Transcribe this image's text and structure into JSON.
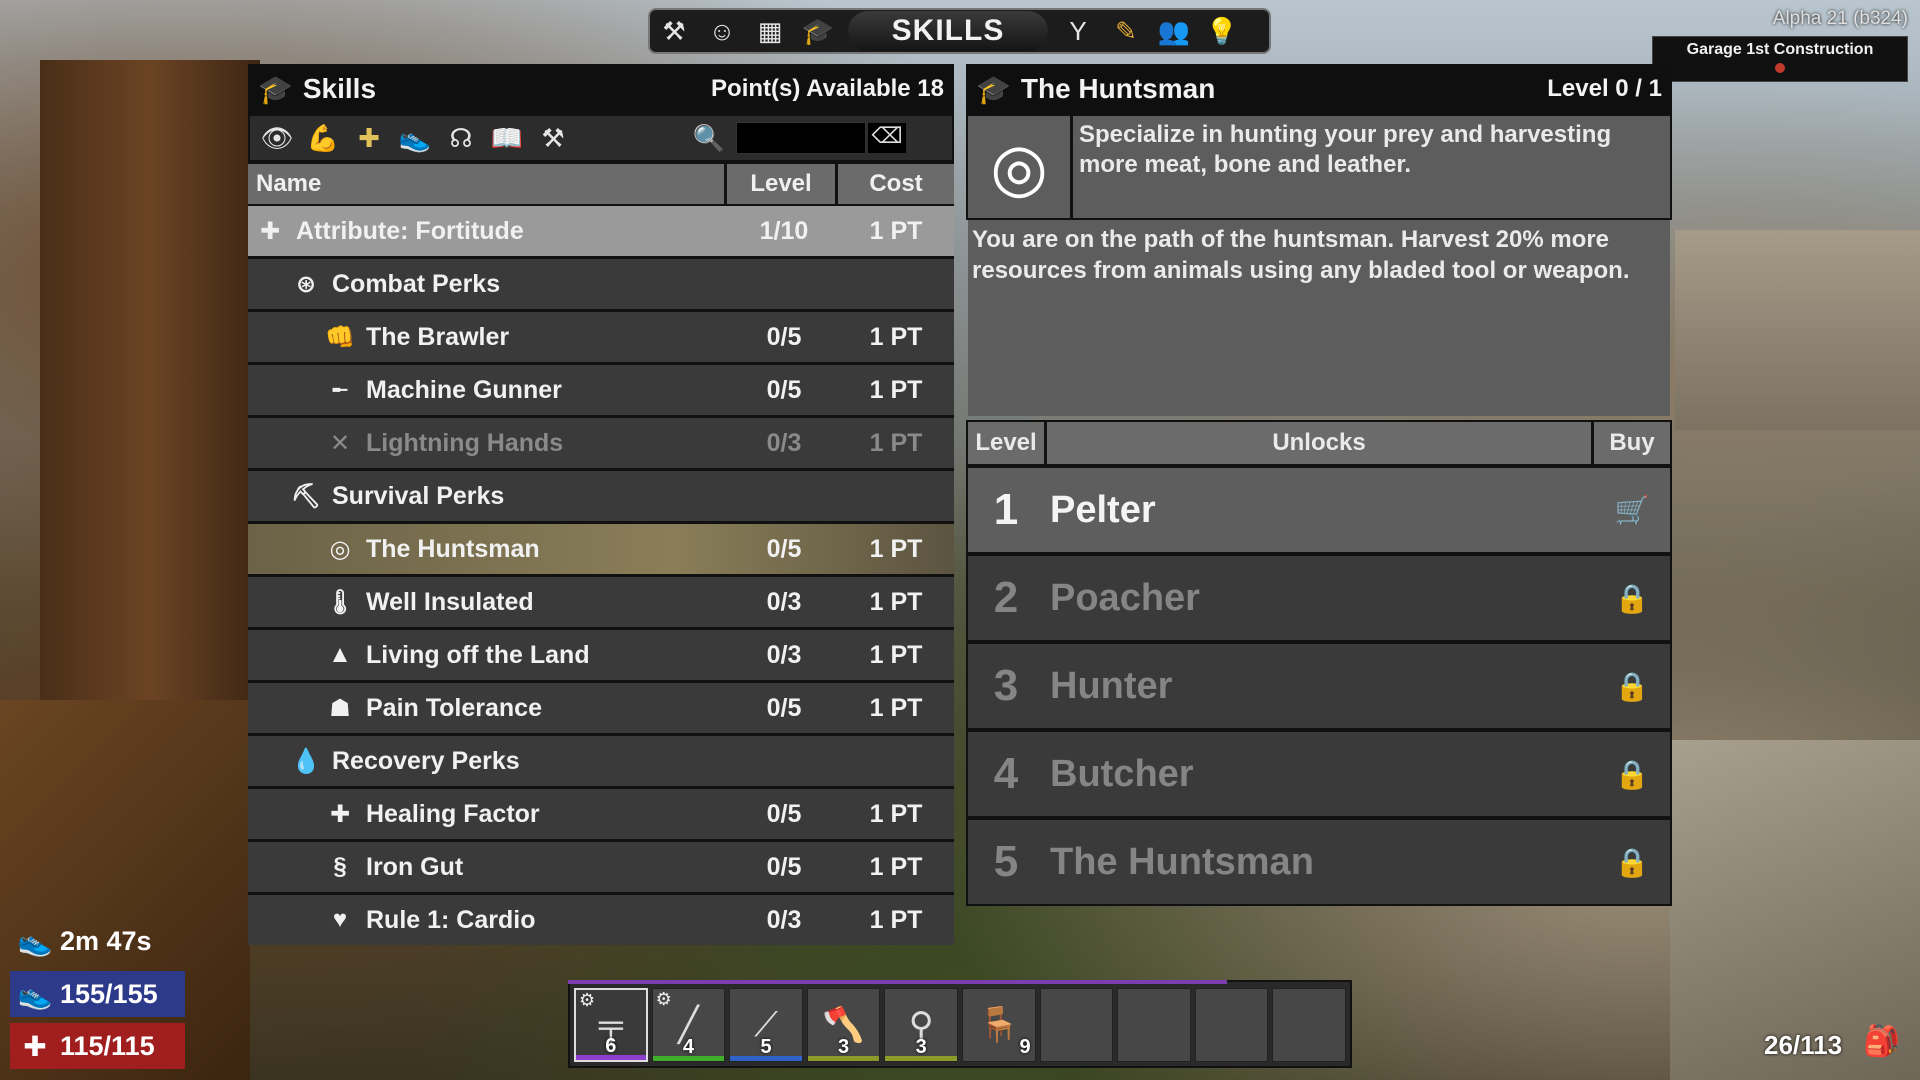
{
  "top_tabs": {
    "title": "SKILLS",
    "icons_left": [
      "hammer-icon",
      "character-icon",
      "map-icon",
      "skills-cap-icon"
    ],
    "icons_right": [
      "challenges-icon",
      "quest-pencil-icon",
      "players-icon",
      "tips-bulb-icon"
    ]
  },
  "build_version": "Alpha 21 (b324)",
  "quest": {
    "title": "Garage 1st Construction"
  },
  "skills_panel": {
    "title": "Skills",
    "points": "Point(s) Available 18",
    "filters": [
      "eye-icon",
      "strength-arm-icon",
      "fortitude-cross-icon",
      "agility-runner-icon",
      "intellect-brain-icon",
      "books-icon",
      "crafting-hammer-icon"
    ],
    "columns": {
      "name": "Name",
      "level": "Level",
      "cost": "Cost"
    },
    "rows": [
      {
        "icon": "fortitude-cross-icon",
        "glyph": "✚",
        "name": "Attribute: Fortitude",
        "level": "1/10",
        "cost": "1 PT",
        "kind": "attribute depth0"
      },
      {
        "icon": "combat-perks-icon",
        "glyph": "⊛",
        "name": "Combat Perks",
        "level": "",
        "cost": "",
        "kind": "category depth1"
      },
      {
        "icon": "brawler-icon",
        "glyph": "👊",
        "name": "The Brawler",
        "level": "0/5",
        "cost": "1 PT",
        "kind": "perk depth2"
      },
      {
        "icon": "machine-gun-icon",
        "glyph": "╾",
        "name": "Machine Gunner",
        "level": "0/5",
        "cost": "1 PT",
        "kind": "perk depth2"
      },
      {
        "icon": "crossed-tools-icon",
        "glyph": "✕",
        "name": "Lightning Hands",
        "level": "0/3",
        "cost": "1 PT",
        "kind": "perk depth2 locked"
      },
      {
        "icon": "survival-perks-icon",
        "glyph": "⛏",
        "name": "Survival Perks",
        "level": "",
        "cost": "",
        "kind": "category depth1"
      },
      {
        "icon": "target-icon",
        "glyph": "◎",
        "name": "The Huntsman",
        "level": "0/5",
        "cost": "1 PT",
        "kind": "perk depth2 selected"
      },
      {
        "icon": "thermometer-icon",
        "glyph": "🌡",
        "name": "Well Insulated",
        "level": "0/3",
        "cost": "1 PT",
        "kind": "perk depth2"
      },
      {
        "icon": "pine-tree-icon",
        "glyph": "▲",
        "name": "Living off the Land",
        "level": "0/3",
        "cost": "1 PT",
        "kind": "perk depth2"
      },
      {
        "icon": "pain-tolerance-icon",
        "glyph": "☗",
        "name": "Pain Tolerance",
        "level": "0/5",
        "cost": "1 PT",
        "kind": "perk depth2"
      },
      {
        "icon": "water-drop-icon",
        "glyph": "💧",
        "name": "Recovery Perks",
        "level": "",
        "cost": "",
        "kind": "category depth1"
      },
      {
        "icon": "healing-plus-icon",
        "glyph": "✚",
        "name": "Healing Factor",
        "level": "0/5",
        "cost": "1 PT",
        "kind": "perk depth2"
      },
      {
        "icon": "stomach-icon",
        "glyph": "§",
        "name": "Iron Gut",
        "level": "0/5",
        "cost": "1 PT",
        "kind": "perk depth2"
      },
      {
        "icon": "heart-pulse-icon",
        "glyph": "♥",
        "name": "Rule 1: Cardio",
        "level": "0/3",
        "cost": "1 PT",
        "kind": "perk depth2"
      }
    ]
  },
  "detail_panel": {
    "title": "The Huntsman",
    "level": "Level 0 / 1",
    "icon": "target-icon",
    "short_desc": "Specialize in hunting your prey and harvesting more meat, bone and leather.",
    "long_desc": "You are on the path of the huntsman. Harvest 20% more resources from animals using any bladed tool or weapon.",
    "columns": {
      "level": "Level",
      "unlocks": "Unlocks",
      "buy": "Buy"
    },
    "unlocks": [
      {
        "num": "1",
        "name": "Pelter",
        "status": "available",
        "icon": "cart-icon"
      },
      {
        "num": "2",
        "name": "Poacher",
        "status": "locked",
        "icon": "lock-icon"
      },
      {
        "num": "3",
        "name": "Hunter",
        "status": "locked",
        "icon": "lock-icon"
      },
      {
        "num": "4",
        "name": "Butcher",
        "status": "locked",
        "icon": "lock-icon"
      },
      {
        "num": "5",
        "name": "The Huntsman",
        "status": "locked",
        "icon": "lock-icon"
      }
    ]
  },
  "hud": {
    "time": "2m 47s",
    "stamina": "155/155",
    "health": "115/115"
  },
  "toolbelt": {
    "xp_fraction": 0.84,
    "slots": [
      {
        "item": "smg-icon",
        "count": "6",
        "gear": true,
        "dur_color": "#8e3fd0",
        "selected": true
      },
      {
        "item": "rifle-icon",
        "count": "4",
        "gear": true,
        "dur_color": "#3fae2a",
        "selected": false
      },
      {
        "item": "machete-icon",
        "count": "5",
        "gear": false,
        "dur_color": "#2f63c9",
        "selected": false
      },
      {
        "item": "axe-icon",
        "count": "3",
        "gear": false,
        "dur_color": "#8c9a2a",
        "selected": false
      },
      {
        "item": "torch-icon",
        "count": "3",
        "gear": false,
        "dur_color": "#8c9a2a",
        "selected": false
      },
      {
        "item": "chair-icon",
        "count": "9",
        "gear": false,
        "dur_color": "",
        "selected": false
      },
      {
        "item": "",
        "count": "",
        "gear": false,
        "dur_color": "",
        "selected": false
      },
      {
        "item": "",
        "count": "",
        "gear": false,
        "dur_color": "",
        "selected": false
      },
      {
        "item": "",
        "count": "",
        "gear": false,
        "dur_color": "",
        "selected": false
      },
      {
        "item": "",
        "count": "",
        "gear": false,
        "dur_color": "",
        "selected": false
      }
    ]
  },
  "inventory": {
    "count": "26/113"
  }
}
